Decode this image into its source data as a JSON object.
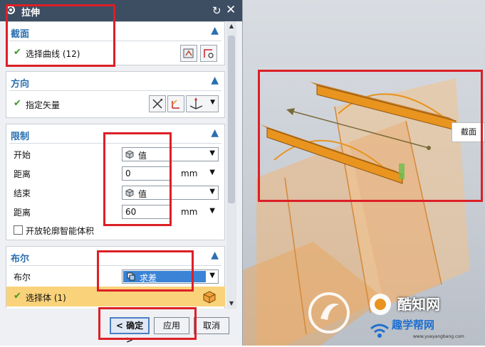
{
  "dialog": {
    "title": "拉伸"
  },
  "section": {
    "header": "截面",
    "select_curve": "选择曲线 (12)"
  },
  "direction": {
    "header": "方向",
    "specify_vector": "指定矢量"
  },
  "limits": {
    "header": "限制",
    "start_label": "开始",
    "start_option": "值",
    "distance1_label": "距离",
    "distance1_value": "0",
    "distance1_unit": "mm",
    "end_label": "结束",
    "end_option": "值",
    "distance2_label": "距离",
    "distance2_value": "60",
    "distance2_unit": "mm",
    "open_profile": "开放轮廓智能体积"
  },
  "boolean": {
    "header": "布尔",
    "boolean_label": "布尔",
    "boolean_value": "求差",
    "select_body": "选择体 (1)"
  },
  "buttons": {
    "ok": "< 确定 >",
    "apply": "应用",
    "cancel": "取消"
  },
  "viewport": {
    "callout": "截面"
  },
  "watermark": {
    "brand": "酷知网",
    "brand2": "趣学帮网",
    "url": "www.yueyangbang.com"
  },
  "colors": {
    "title_bar": "#3d4e63",
    "header_text": "#2a6fb0",
    "highlight": "#f9d27a",
    "annotation": "#dc1f26",
    "part": "#e8941e"
  }
}
